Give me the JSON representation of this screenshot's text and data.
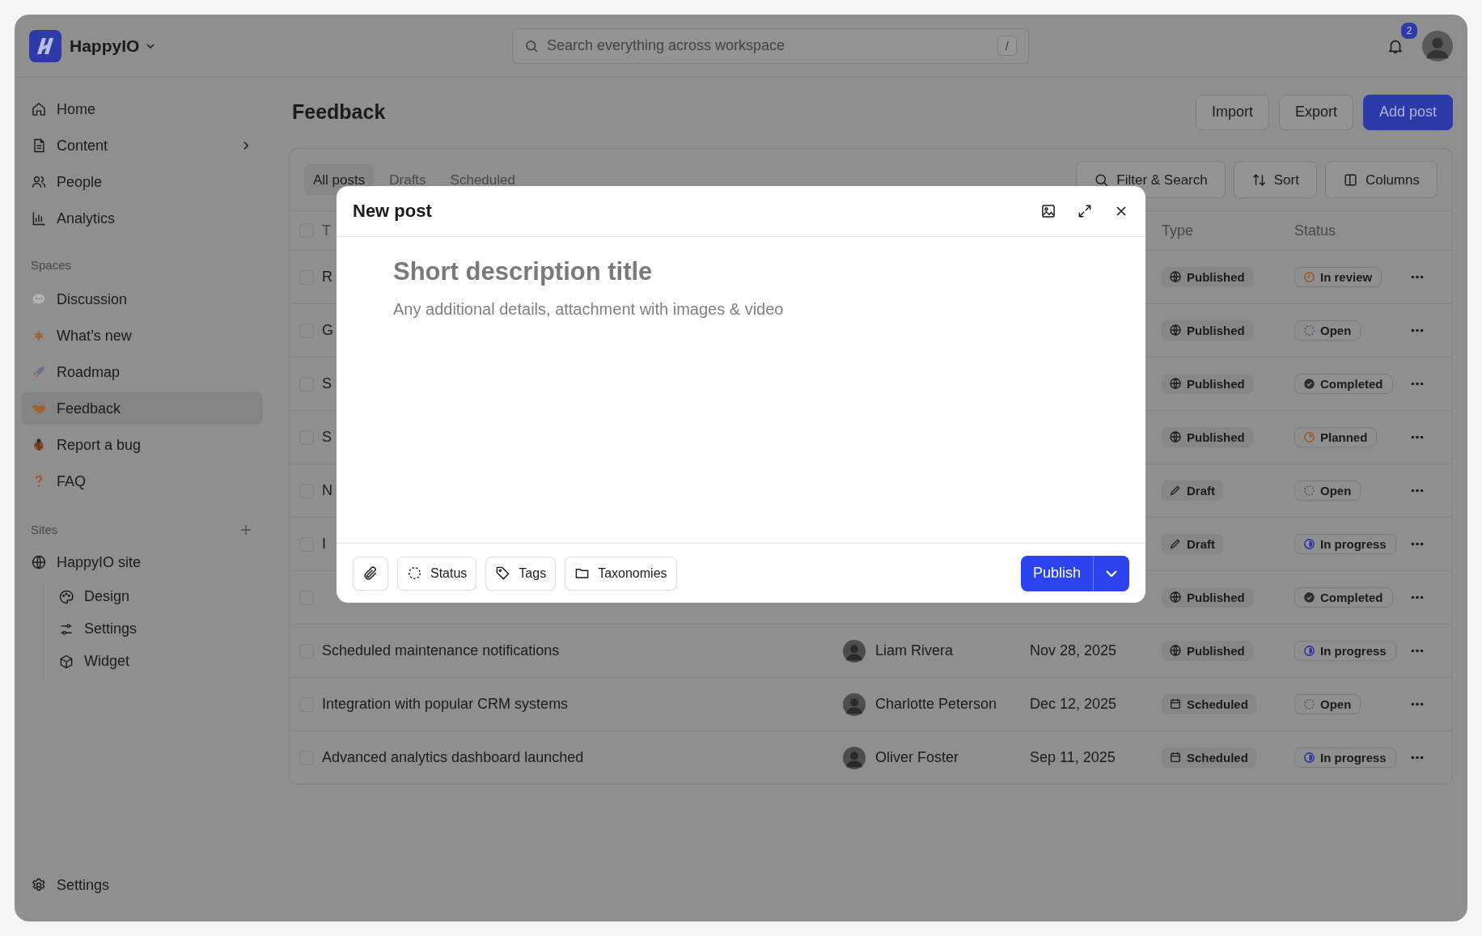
{
  "app": {
    "name": "HappyIO"
  },
  "search": {
    "placeholder": "Search everything across workspace",
    "shortcut": "/"
  },
  "notifications": {
    "count": "2"
  },
  "sidebar": {
    "nav": [
      {
        "label": "Home",
        "expandable": false
      },
      {
        "label": "Content",
        "expandable": true
      },
      {
        "label": "People",
        "expandable": false
      },
      {
        "label": "Analytics",
        "expandable": false
      }
    ],
    "spaces_label": "Spaces",
    "spaces": [
      {
        "label": "Discussion",
        "selected": false
      },
      {
        "label": "What’s new",
        "selected": false
      },
      {
        "label": "Roadmap",
        "selected": false
      },
      {
        "label": "Feedback",
        "selected": true
      },
      {
        "label": "Report a bug",
        "selected": false
      },
      {
        "label": "FAQ",
        "selected": false
      }
    ],
    "sites_label": "Sites",
    "sites": [
      {
        "label": "HappyIO site",
        "children": [
          {
            "label": "Design"
          },
          {
            "label": "Settings"
          },
          {
            "label": "Widget"
          }
        ]
      }
    ],
    "footer": {
      "label": "Settings"
    }
  },
  "page": {
    "title": "Feedback",
    "actions": [
      {
        "label": "Import",
        "kind": "secondary"
      },
      {
        "label": "Export",
        "kind": "secondary"
      },
      {
        "label": "Add post",
        "kind": "primary"
      }
    ]
  },
  "tabs": [
    {
      "label": "All posts",
      "selected": true
    },
    {
      "label": "Drafts",
      "selected": false
    },
    {
      "label": "Scheduled",
      "selected": false
    }
  ],
  "toolbar": [
    {
      "label": "Filter & Search"
    },
    {
      "label": "Sort"
    },
    {
      "label": "Columns"
    }
  ],
  "table": {
    "header": {
      "checked": false,
      "column_1": "T",
      "type": "Type",
      "status": "Status"
    },
    "rows": [
      {
        "checked": false,
        "title": "R",
        "type": {
          "label": "Published",
          "kind": "published"
        },
        "status": {
          "label": "In review",
          "kind": "in_review"
        }
      },
      {
        "checked": false,
        "title": "G",
        "type": {
          "label": "Published",
          "kind": "published"
        },
        "status": {
          "label": "Open",
          "kind": "open"
        }
      },
      {
        "checked": false,
        "title": "S",
        "type": {
          "label": "Published",
          "kind": "published"
        },
        "status": {
          "label": "Completed",
          "kind": "completed"
        }
      },
      {
        "checked": false,
        "title": "S",
        "type": {
          "label": "Published",
          "kind": "published"
        },
        "status": {
          "label": "Planned",
          "kind": "planned"
        }
      },
      {
        "checked": false,
        "title": "N",
        "type": {
          "label": "Draft",
          "kind": "draft"
        },
        "status": {
          "label": "Open",
          "kind": "open"
        }
      },
      {
        "checked": false,
        "title": "I",
        "type": {
          "label": "Draft",
          "kind": "draft"
        },
        "status": {
          "label": "In progress",
          "kind": "in_progress"
        }
      },
      {
        "checked": false,
        "type": {
          "label": "Published",
          "kind": "published"
        },
        "status": {
          "label": "Completed",
          "kind": "completed"
        }
      },
      {
        "checked": false,
        "title": "Scheduled maintenance notifications",
        "author": "Liam Rivera",
        "date": "Nov 28, 2025",
        "type": {
          "label": "Published",
          "kind": "published"
        },
        "status": {
          "label": "In progress",
          "kind": "in_progress"
        }
      },
      {
        "checked": false,
        "title": "Integration with popular CRM systems",
        "author": "Charlotte Peterson",
        "date": "Dec 12, 2025",
        "type": {
          "label": "Scheduled",
          "kind": "scheduled"
        },
        "status": {
          "label": "Open",
          "kind": "open"
        }
      },
      {
        "checked": false,
        "title": "Advanced analytics dashboard launched",
        "author": "Oliver Foster",
        "date": "Sep 11, 2025",
        "type": {
          "label": "Scheduled",
          "kind": "scheduled"
        },
        "status": {
          "label": "In progress",
          "kind": "in_progress"
        }
      }
    ]
  },
  "modal": {
    "title": "New post",
    "title_placeholder": "Short description title",
    "body_placeholder": "Any additional details, attachment with images & video",
    "tools": [
      {
        "label": "Status"
      },
      {
        "label": "Tags"
      },
      {
        "label": "Taxonomies"
      }
    ],
    "submit": "Publish"
  }
}
